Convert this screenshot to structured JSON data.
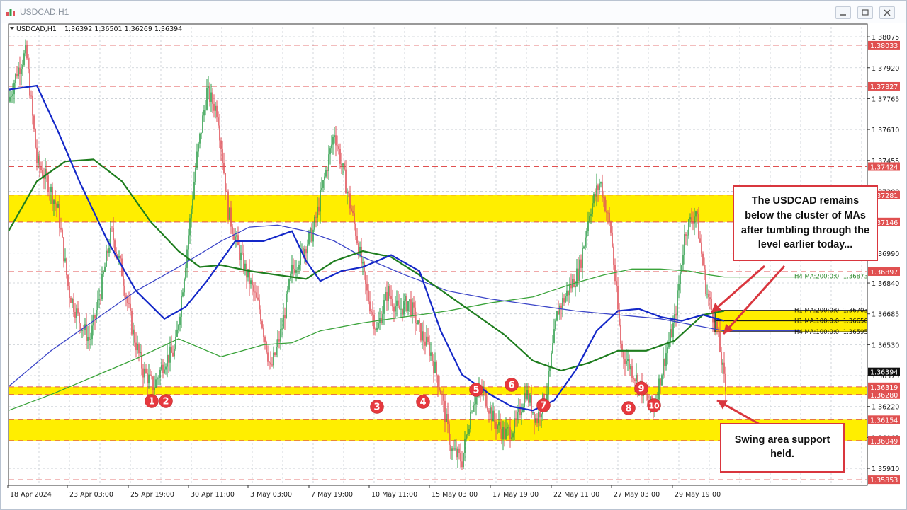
{
  "window": {
    "title": "USDCAD,H1"
  },
  "chart_header": {
    "symbol": "USDCAD,H1",
    "ohlc": "1.36392 1.36501 1.36269 1.36394"
  },
  "colors": {
    "bull": "#2e9e4a",
    "bear": "#e0525a",
    "zone": "#ffee00",
    "ma_blue": "#1428c8",
    "ma_green": "#1e7d1e",
    "ma_h4_100": "#3c46c8",
    "ma_h4_200": "#3aa33a",
    "level_line": "#e05050",
    "callout_border": "#d9363e"
  },
  "chart_data": {
    "type": "candlestick",
    "y_range": [
      1.35825,
      1.38125
    ],
    "y_ticks": [
      "1.38075",
      "1.37920",
      "1.37765",
      "1.37610",
      "1.37455",
      "1.37300",
      "1.37145",
      "1.36990",
      "1.36840",
      "1.36685",
      "1.36530",
      "1.36375",
      "1.36220",
      "1.36065",
      "1.35910"
    ],
    "x_ticks": [
      "18 Apr 2024",
      "23 Apr 03:00",
      "25 Apr 19:00",
      "30 Apr 11:00",
      "3 May 03:00",
      "7 May 19:00",
      "10 May 11:00",
      "15 May 03:00",
      "17 May 19:00",
      "22 May 11:00",
      "27 May 03:00",
      "29 May 19:00"
    ],
    "price_levels": [
      {
        "label": "1.38033",
        "value": 1.38033
      },
      {
        "label": "1.37827",
        "value": 1.37827
      },
      {
        "label": "1.37424",
        "value": 1.37424
      },
      {
        "label": "1.37281",
        "value": 1.37281
      },
      {
        "label": "1.37146",
        "value": 1.37146
      },
      {
        "label": "1.36897",
        "value": 1.36897
      },
      {
        "label": "1.36319",
        "value": 1.36319
      },
      {
        "label": "1.36280",
        "value": 1.3628
      },
      {
        "label": "1.36154",
        "value": 1.36154
      },
      {
        "label": "1.36049",
        "value": 1.36049
      },
      {
        "label": "1.35853",
        "value": 1.35853
      }
    ],
    "zones": [
      [
        1.37146,
        1.37281
      ],
      [
        1.3628,
        1.36319
      ],
      [
        1.36049,
        1.36154
      ]
    ],
    "ma_zone": [
      1.36595,
      1.36703
    ],
    "current_price": "1.36394",
    "ma_labels": [
      {
        "text": "H4 MA:200:0:0: 1.36873",
        "value": 1.36873
      },
      {
        "text": "H1 MA:200:0:0: 1.36703",
        "value": 1.36703
      },
      {
        "text": "H1 MA:100:0:0: 1.36650",
        "value": 1.3665
      },
      {
        "text": "H4 MA:100:0:0: 1.36595",
        "value": 1.36595
      }
    ],
    "swing_markers": [
      "1",
      "2",
      "3",
      "4",
      "5",
      "6",
      "7",
      "8",
      "9",
      "10"
    ],
    "price_path": [
      [
        0,
        1.3775
      ],
      [
        12,
        1.379
      ],
      [
        25,
        1.38
      ],
      [
        40,
        1.3745
      ],
      [
        55,
        1.3735
      ],
      [
        70,
        1.372
      ],
      [
        85,
        1.368
      ],
      [
        100,
        1.3665
      ],
      [
        115,
        1.3655
      ],
      [
        130,
        1.368
      ],
      [
        145,
        1.371
      ],
      [
        160,
        1.369
      ],
      [
        175,
        1.366
      ],
      [
        190,
        1.364
      ],
      [
        205,
        1.3632
      ],
      [
        220,
        1.3645
      ],
      [
        235,
        1.365
      ],
      [
        250,
        1.3695
      ],
      [
        265,
        1.3745
      ],
      [
        280,
        1.378
      ],
      [
        295,
        1.377
      ],
      [
        310,
        1.372
      ],
      [
        325,
        1.37
      ],
      [
        340,
        1.3685
      ],
      [
        355,
        1.367
      ],
      [
        370,
        1.364
      ],
      [
        385,
        1.366
      ],
      [
        400,
        1.369
      ],
      [
        415,
        1.37
      ],
      [
        430,
        1.371
      ],
      [
        445,
        1.3735
      ],
      [
        460,
        1.376
      ],
      [
        475,
        1.3735
      ],
      [
        490,
        1.371
      ],
      [
        505,
        1.368
      ],
      [
        520,
        1.366
      ],
      [
        535,
        1.368
      ],
      [
        550,
        1.367
      ],
      [
        565,
        1.3675
      ],
      [
        580,
        1.366
      ],
      [
        595,
        1.365
      ],
      [
        610,
        1.363
      ],
      [
        625,
        1.36
      ],
      [
        640,
        1.3595
      ],
      [
        655,
        1.3625
      ],
      [
        670,
        1.363
      ],
      [
        685,
        1.3615
      ],
      [
        700,
        1.3608
      ],
      [
        715,
        1.3612
      ],
      [
        730,
        1.363
      ],
      [
        745,
        1.3615
      ],
      [
        760,
        1.363
      ],
      [
        775,
        1.367
      ],
      [
        790,
        1.368
      ],
      [
        805,
        1.369
      ],
      [
        820,
        1.372
      ],
      [
        835,
        1.3735
      ],
      [
        850,
        1.371
      ],
      [
        865,
        1.365
      ],
      [
        880,
        1.364
      ],
      [
        895,
        1.363
      ],
      [
        910,
        1.362
      ],
      [
        925,
        1.3645
      ],
      [
        940,
        1.3665
      ],
      [
        955,
        1.371
      ],
      [
        970,
        1.372
      ],
      [
        985,
        1.368
      ],
      [
        1000,
        1.366
      ],
      [
        1012,
        1.363
      ],
      [
        1015,
        1.3639
      ]
    ],
    "ma_h1_100": [
      [
        0,
        1.3781
      ],
      [
        40,
        1.3783
      ],
      [
        70,
        1.376
      ],
      [
        100,
        1.3735
      ],
      [
        140,
        1.3705
      ],
      [
        180,
        1.368
      ],
      [
        220,
        1.3666
      ],
      [
        250,
        1.3672
      ],
      [
        280,
        1.3685
      ],
      [
        320,
        1.3705
      ],
      [
        360,
        1.3705
      ],
      [
        400,
        1.371
      ],
      [
        420,
        1.3695
      ],
      [
        440,
        1.3685
      ],
      [
        470,
        1.369
      ],
      [
        500,
        1.3692
      ],
      [
        540,
        1.3698
      ],
      [
        580,
        1.369
      ],
      [
        610,
        1.366
      ],
      [
        640,
        1.3638
      ],
      [
        680,
        1.3628
      ],
      [
        710,
        1.3622
      ],
      [
        740,
        1.362
      ],
      [
        770,
        1.3625
      ],
      [
        800,
        1.364
      ],
      [
        830,
        1.366
      ],
      [
        860,
        1.367
      ],
      [
        890,
        1.3671
      ],
      [
        920,
        1.3667
      ],
      [
        950,
        1.3665
      ],
      [
        980,
        1.3668
      ],
      [
        1010,
        1.3665
      ]
    ],
    "ma_h1_200": [
      [
        0,
        1.371
      ],
      [
        40,
        1.3735
      ],
      [
        80,
        1.3745
      ],
      [
        120,
        1.3746
      ],
      [
        160,
        1.3735
      ],
      [
        200,
        1.3715
      ],
      [
        240,
        1.37
      ],
      [
        270,
        1.3692
      ],
      [
        300,
        1.3693
      ],
      [
        340,
        1.369
      ],
      [
        380,
        1.3688
      ],
      [
        420,
        1.3686
      ],
      [
        460,
        1.3695
      ],
      [
        500,
        1.37
      ],
      [
        540,
        1.3697
      ],
      [
        580,
        1.3688
      ],
      [
        620,
        1.3678
      ],
      [
        660,
        1.3668
      ],
      [
        700,
        1.3658
      ],
      [
        740,
        1.3645
      ],
      [
        780,
        1.364
      ],
      [
        820,
        1.3644
      ],
      [
        860,
        1.365
      ],
      [
        900,
        1.365
      ],
      [
        940,
        1.3655
      ],
      [
        980,
        1.3668
      ],
      [
        1010,
        1.367
      ]
    ],
    "ma_h4_100": [
      [
        0,
        1.3632
      ],
      [
        60,
        1.365
      ],
      [
        120,
        1.3665
      ],
      [
        180,
        1.368
      ],
      [
        240,
        1.3692
      ],
      [
        300,
        1.3705
      ],
      [
        340,
        1.3712
      ],
      [
        380,
        1.3713
      ],
      [
        420,
        1.371
      ],
      [
        460,
        1.3705
      ],
      [
        500,
        1.3697
      ],
      [
        560,
        1.3688
      ],
      [
        620,
        1.368
      ],
      [
        680,
        1.3676
      ],
      [
        740,
        1.3673
      ],
      [
        800,
        1.367
      ],
      [
        860,
        1.3668
      ],
      [
        920,
        1.3666
      ],
      [
        980,
        1.3662
      ],
      [
        1010,
        1.366
      ]
    ],
    "ma_h4_200": [
      [
        0,
        1.362
      ],
      [
        60,
        1.3628
      ],
      [
        120,
        1.3637
      ],
      [
        180,
        1.3646
      ],
      [
        240,
        1.3656
      ],
      [
        300,
        1.3647
      ],
      [
        360,
        1.3653
      ],
      [
        400,
        1.3654
      ],
      [
        440,
        1.366
      ],
      [
        500,
        1.3664
      ],
      [
        560,
        1.3667
      ],
      [
        620,
        1.367
      ],
      [
        680,
        1.3674
      ],
      [
        740,
        1.3677
      ],
      [
        800,
        1.3684
      ],
      [
        840,
        1.3688
      ],
      [
        880,
        1.3691
      ],
      [
        920,
        1.3691
      ],
      [
        960,
        1.369
      ],
      [
        990,
        1.3688
      ],
      [
        1010,
        1.3687
      ]
    ]
  },
  "annotations": {
    "main_callout": "The USDCAD remains below the cluster of MAs after tumbling through the level earlier today...",
    "support_callout": "Swing area support held."
  }
}
